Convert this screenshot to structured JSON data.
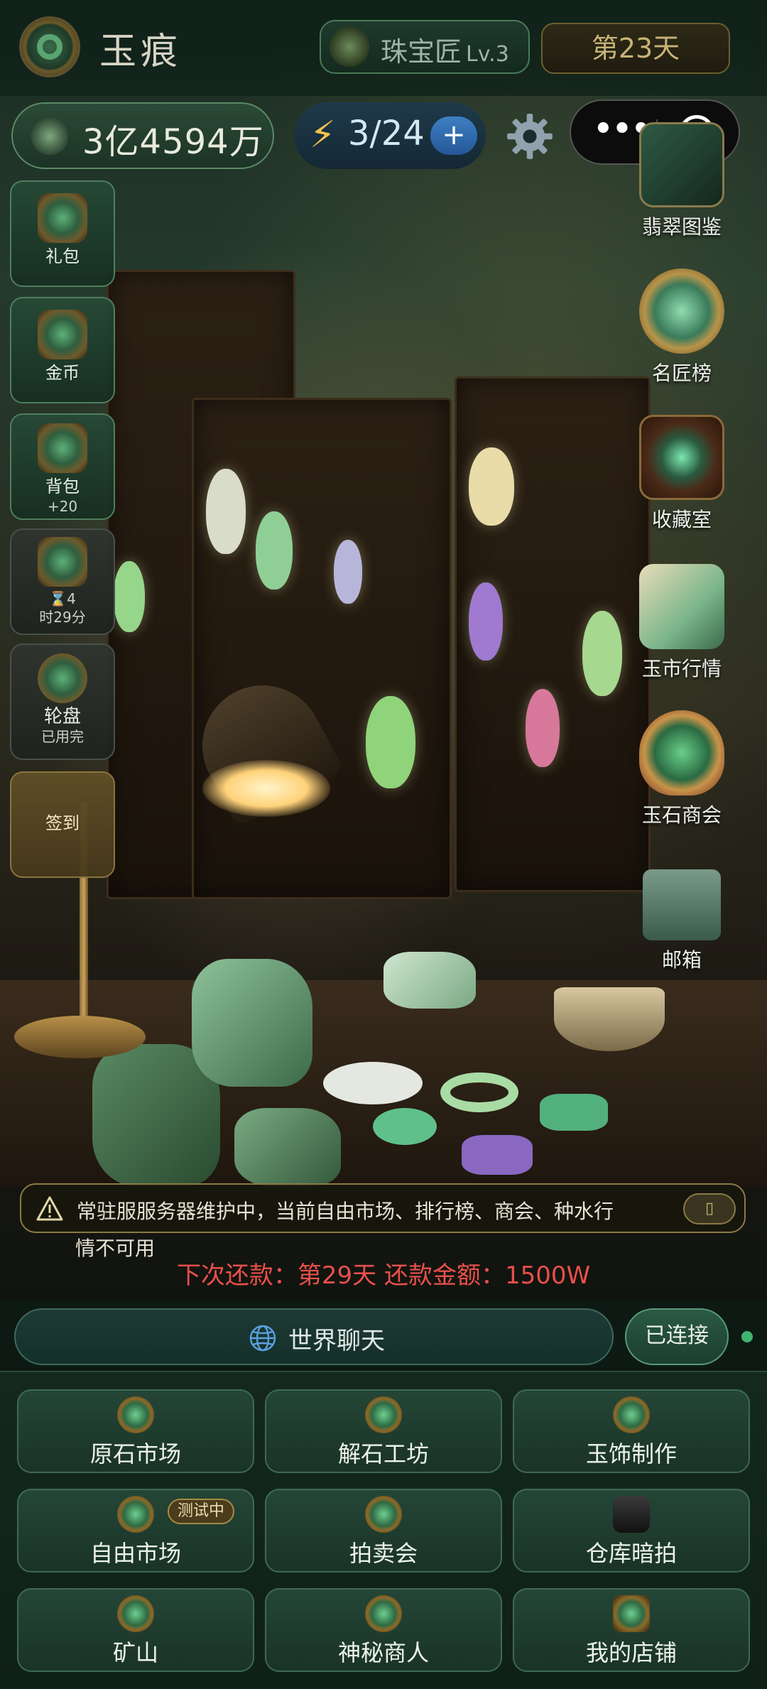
{
  "header": {
    "app_title": "玉痕",
    "rank_title": "珠宝匠",
    "rank_level": "Lv.3",
    "day": "第23天"
  },
  "resources": {
    "money": "3亿4594万",
    "energy": "3/24",
    "energy_add": "+"
  },
  "left_menu": [
    {
      "label": "礼包",
      "sub": "",
      "icon": "gift-chest-icon"
    },
    {
      "label": "金币",
      "sub": "",
      "icon": "gold-coin-icon"
    },
    {
      "label": "背包",
      "sub": "+20",
      "icon": "backpack-icon"
    },
    {
      "label": "",
      "sub": "时29分",
      "icon": "treasure-chest-icon",
      "timer_prefix": "⌛4"
    },
    {
      "label": "轮盘",
      "sub": "已用完",
      "icon": "roulette-icon"
    },
    {
      "label": "签到",
      "sub": "",
      "icon": "checkin-icon"
    }
  ],
  "right_menu": [
    {
      "label": "翡翠图鉴",
      "icon": "jade-catalog-icon"
    },
    {
      "label": "名匠榜",
      "icon": "master-ranking-icon"
    },
    {
      "label": "收藏室",
      "icon": "collection-room-icon"
    },
    {
      "label": "玉市行情",
      "icon": "jade-market-trend-icon"
    },
    {
      "label": "玉石商会",
      "icon": "jade-guild-icon"
    },
    {
      "label": "邮箱",
      "icon": "mailbox-icon"
    }
  ],
  "notice": {
    "message_line1": "常驻服服务器维护中，当前自由市场、排行榜、商会、种水行",
    "message_line2": "情不可用",
    "close_label": "▯"
  },
  "repayment": "下次还款：第29天  还款金额：1500W",
  "chat": {
    "world_chat": "世界聊天",
    "status": "已连接"
  },
  "grid": [
    {
      "label": "原石市场",
      "icon": "raw-stone-market-icon",
      "tag": ""
    },
    {
      "label": "解石工坊",
      "icon": "stone-cutting-workshop-icon",
      "tag": ""
    },
    {
      "label": "玉饰制作",
      "icon": "jade-crafting-icon",
      "tag": ""
    },
    {
      "label": "自由市场",
      "icon": "free-market-icon",
      "tag": "测试中"
    },
    {
      "label": "拍卖会",
      "icon": "auction-icon",
      "tag": ""
    },
    {
      "label": "仓库暗拍",
      "icon": "warehouse-auction-icon",
      "tag": ""
    },
    {
      "label": "矿山",
      "icon": "mine-icon",
      "tag": ""
    },
    {
      "label": "神秘商人",
      "icon": "mystery-merchant-icon",
      "tag": ""
    },
    {
      "label": "我的店铺",
      "icon": "my-shop-icon",
      "tag": ""
    }
  ],
  "colors": {
    "accent_green": "#3fb370",
    "repay_red": "#e8504a",
    "gold": "#c8b376"
  }
}
